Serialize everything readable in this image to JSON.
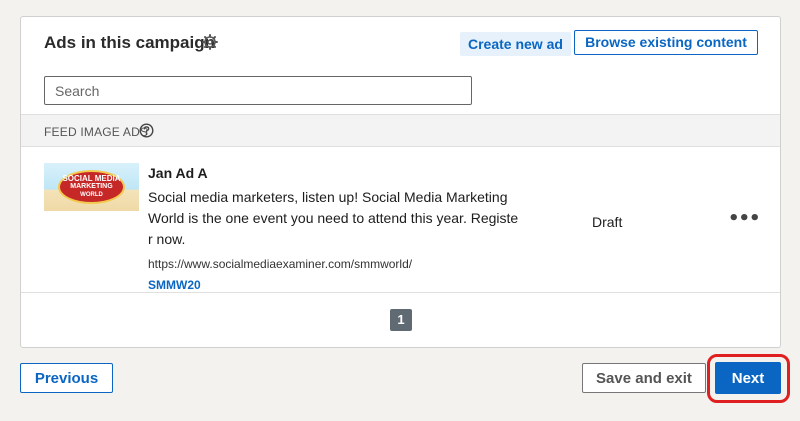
{
  "header": {
    "title": "Ads in this campaign",
    "create_label": "Create new ad",
    "browse_label": "Browse existing content"
  },
  "search": {
    "placeholder": "Search",
    "value": ""
  },
  "section": {
    "label": "FEED IMAGE ADS"
  },
  "ad": {
    "name": "Jan Ad A",
    "body": "Social media marketers, listen up! Social Media Marketing World is the one event you need to attend this year. Register now.",
    "url": "https://www.socialmediaexaminer.com/smmworld/",
    "tag": "SMMW20",
    "status": "Draft",
    "thumbnail": {
      "line1": "SOCIAL MEDIA",
      "line2": "MARKETING",
      "line3": "WORLD"
    }
  },
  "pagination": {
    "current_page": "1"
  },
  "footer": {
    "previous_label": "Previous",
    "save_exit_label": "Save and exit",
    "next_label": "Next"
  },
  "colors": {
    "accent": "#0a66c2",
    "highlight": "#e02020"
  },
  "icons": {
    "settings": "gear-icon",
    "help": "question-circle-icon",
    "more": "more-horizontal-icon"
  }
}
